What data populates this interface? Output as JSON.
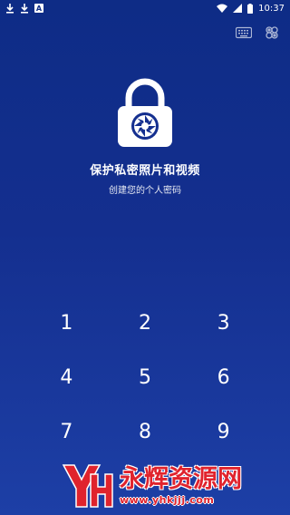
{
  "status_bar": {
    "time": "10:37",
    "icons": [
      "download-icon",
      "download-icon",
      "a-letter-icon",
      "wifi-icon",
      "signal-icon",
      "battery-icon"
    ],
    "notif_letter": "A"
  },
  "toolbar": {
    "icons": [
      "keyboard-icon",
      "gear-cluster-icon"
    ]
  },
  "header": {
    "icon": "camera-lock-icon",
    "title": "保护私密照片和视频",
    "subtitle": "创建您的个人密码"
  },
  "keypad": {
    "keys": [
      "1",
      "2",
      "3",
      "4",
      "5",
      "6",
      "7",
      "8",
      "9"
    ]
  },
  "watermark": {
    "brand": "永辉资源网",
    "url": "www.yhkjjj.com",
    "color": "#e0232d"
  },
  "colors": {
    "background_top": "#0e2c86",
    "background_bottom": "#1d3fa6",
    "foreground": "#ffffff"
  }
}
